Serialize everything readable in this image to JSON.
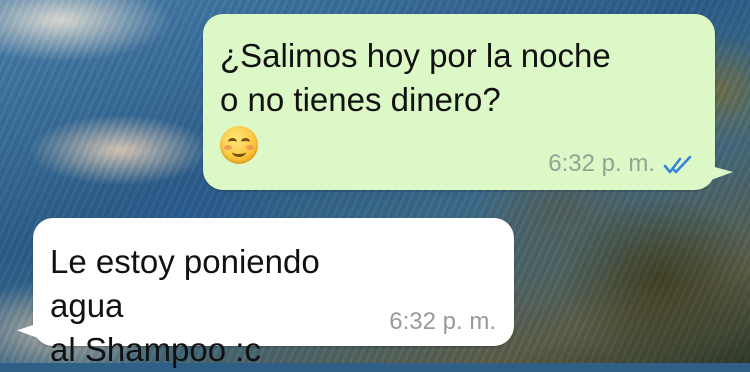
{
  "messages": [
    {
      "direction": "outgoing",
      "text": "¿Salimos hoy por la noche\no no tienes dinero?",
      "emoji": "smiling-face-icon",
      "time": "6:32 p. m.",
      "status": "read-double-check",
      "bubble_color": "#dcf8c6"
    },
    {
      "direction": "incoming",
      "text": "Le estoy poniendo agua\nal Shampoo :c",
      "time": "6:32 p. m.",
      "bubble_color": "#ffffff"
    }
  ],
  "colors": {
    "read_receipt": "#3a82d8"
  }
}
